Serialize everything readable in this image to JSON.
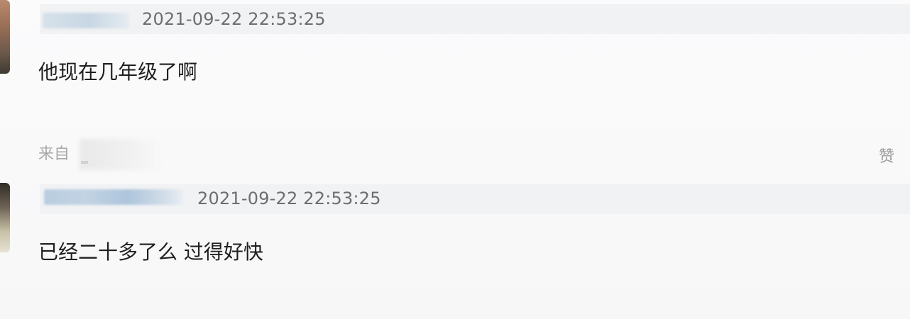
{
  "comments": [
    {
      "timestamp": "2021-09-22 22:53:25",
      "text": "他现在几年级了啊",
      "source_prefix": "来自",
      "reward_label": "赞"
    },
    {
      "timestamp": "2021-09-22 22:53:25",
      "text": "已经二十多了么 过得好快"
    }
  ],
  "colors": {
    "timestamp": "#6d6d6d",
    "comment_text": "#1f1f1f",
    "source_text": "#a9a9a9",
    "header_bar": "#f1f2f4"
  }
}
